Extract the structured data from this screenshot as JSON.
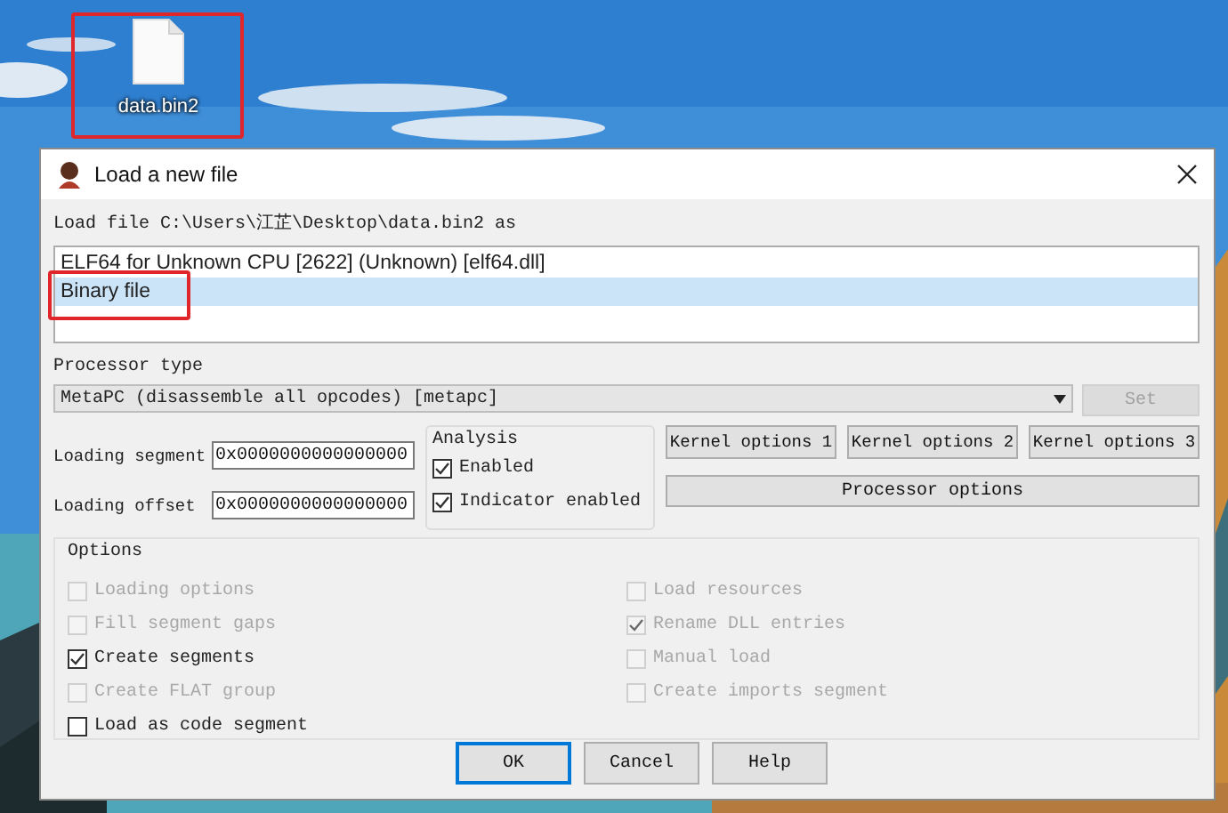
{
  "desktop_icon": {
    "label": "data.bin2"
  },
  "dialog": {
    "title": "Load a new file",
    "load_file_label": "Load file C:\\Users\\江芷\\Desktop\\data.bin2 as",
    "formats": [
      {
        "label": "ELF64 for Unknown CPU [2622] (Unknown) [elf64.dll]",
        "selected": false
      },
      {
        "label": "Binary file",
        "selected": true
      }
    ],
    "processor_type": {
      "label": "Processor type",
      "value": "MetaPC (disassemble all opcodes) [metapc]"
    },
    "set_button": {
      "label": "Set",
      "disabled": true
    },
    "loading_fields": [
      {
        "label": "Loading segment",
        "value": "0x0000000000000000"
      },
      {
        "label": "Loading offset",
        "value": "0x0000000000000000"
      }
    ],
    "analysis": {
      "title": "Analysis",
      "options": [
        {
          "label": "Enabled",
          "checked": true
        },
        {
          "label": "Indicator enabled",
          "checked": true
        }
      ]
    },
    "kernel_buttons": [
      "Kernel options 1",
      "Kernel options 2",
      "Kernel options 3"
    ],
    "processor_options_button": "Processor options",
    "options": {
      "title": "Options",
      "left": [
        {
          "label": "Loading options",
          "checked": false,
          "disabled": true
        },
        {
          "label": "Fill segment gaps",
          "checked": false,
          "disabled": true
        },
        {
          "label": "Create segments",
          "checked": true,
          "disabled": false
        },
        {
          "label": "Create FLAT group",
          "checked": false,
          "disabled": true
        },
        {
          "label": "Load as code segment",
          "checked": false,
          "disabled": false
        }
      ],
      "right": [
        {
          "label": "Load resources",
          "checked": false,
          "disabled": true
        },
        {
          "label": "Rename DLL entries",
          "checked": true,
          "disabled": true
        },
        {
          "label": "Manual load",
          "checked": false,
          "disabled": true
        },
        {
          "label": "Create imports segment",
          "checked": false,
          "disabled": true
        }
      ]
    },
    "buttons": [
      {
        "label": "OK",
        "default": true
      },
      {
        "label": "Cancel",
        "default": false
      },
      {
        "label": "Help",
        "default": false
      }
    ]
  }
}
